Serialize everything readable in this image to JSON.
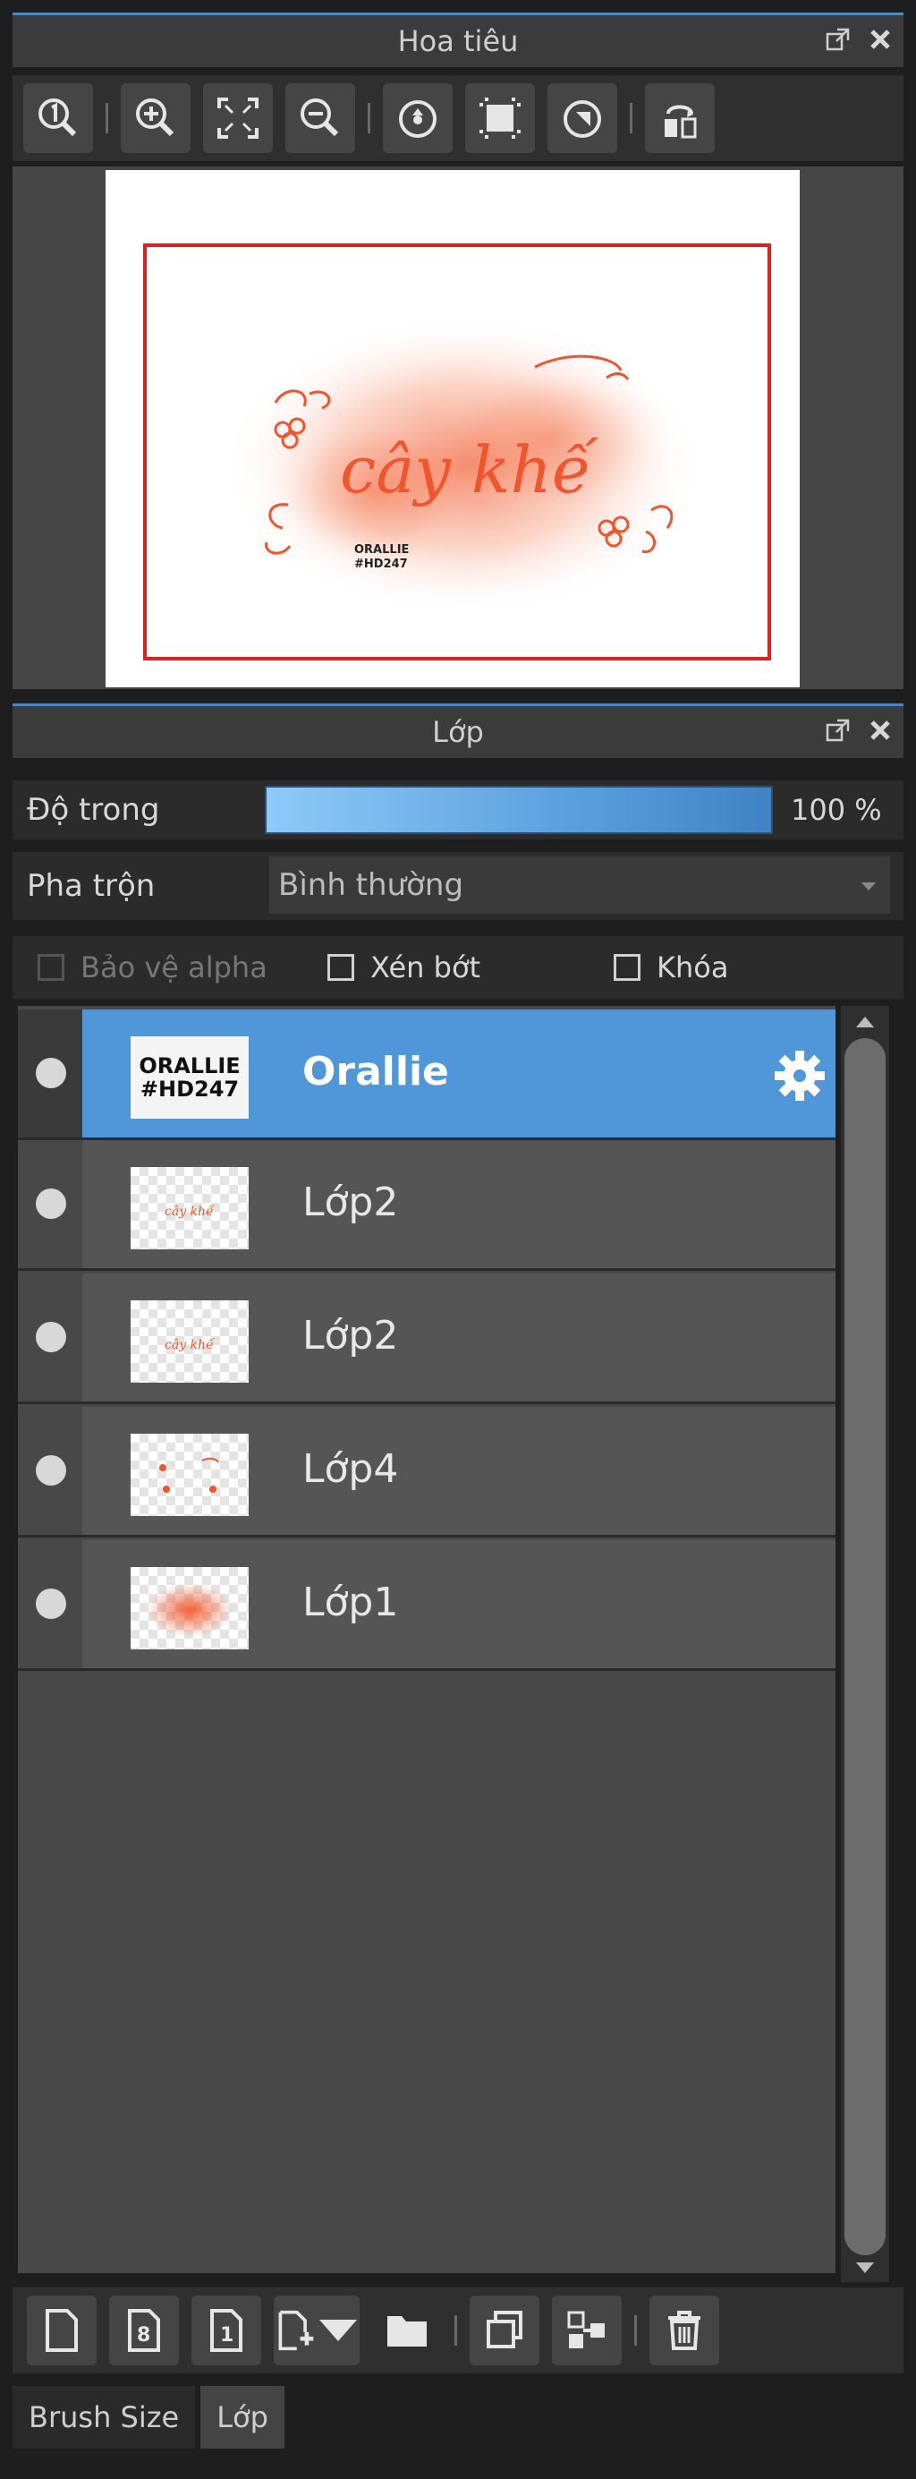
{
  "navigator": {
    "title": "Hoa tiêu",
    "canvas_text": "cây khế",
    "canvas_tag_1": "ORALLIE",
    "canvas_tag_2": "#HD247",
    "accent_color": "#f0552d",
    "viewport_color": "#dd2222"
  },
  "layer_panel": {
    "title": "Lớp",
    "opacity_label": "Độ trong",
    "opacity_value": "100 %",
    "opacity_fraction": 1.0,
    "blend_label": "Pha trộn",
    "blend_value": "Bình thường",
    "protect_alpha_label": "Bảo vệ alpha",
    "clip_label": "Xén bớt",
    "lock_label": "Khóa",
    "layers": [
      {
        "name": "Orallie",
        "thumb_text_1": "ORALLIE",
        "thumb_text_2": "#HD247",
        "active": true
      },
      {
        "name": "Lớp2",
        "active": false
      },
      {
        "name": "Lớp2",
        "active": false
      },
      {
        "name": "Lớp4",
        "active": false
      },
      {
        "name": "Lớp1",
        "active": false
      }
    ]
  },
  "tabs": [
    {
      "label": "Brush Size"
    },
    {
      "label": "Lớp"
    }
  ],
  "colors": {
    "accent": "#4a89c4",
    "active_layer": "#4f97d8"
  }
}
